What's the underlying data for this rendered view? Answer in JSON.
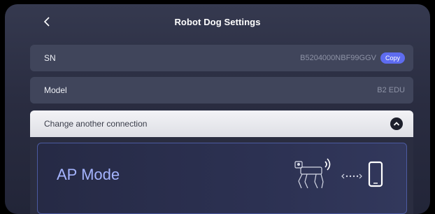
{
  "header": {
    "title": "Robot Dog Settings",
    "back_icon": "chevron-left-icon"
  },
  "rows": {
    "sn": {
      "label": "SN",
      "value": "B5204000NBF99GGV",
      "copy_label": "Copy"
    },
    "model": {
      "label": "Model",
      "value": "B2 EDU"
    }
  },
  "connection": {
    "label": "Change another connection",
    "toggle_icon": "chevron-up-icon"
  },
  "mode_card": {
    "label": "AP Mode",
    "icons": [
      "robot-dog-icon",
      "wireless-signal-icon",
      "dots-arrow-icon",
      "phone-icon"
    ]
  },
  "colors": {
    "accent": "#5e6cf0",
    "mode_text": "#a5b4ff",
    "background": "#2a2d41"
  }
}
